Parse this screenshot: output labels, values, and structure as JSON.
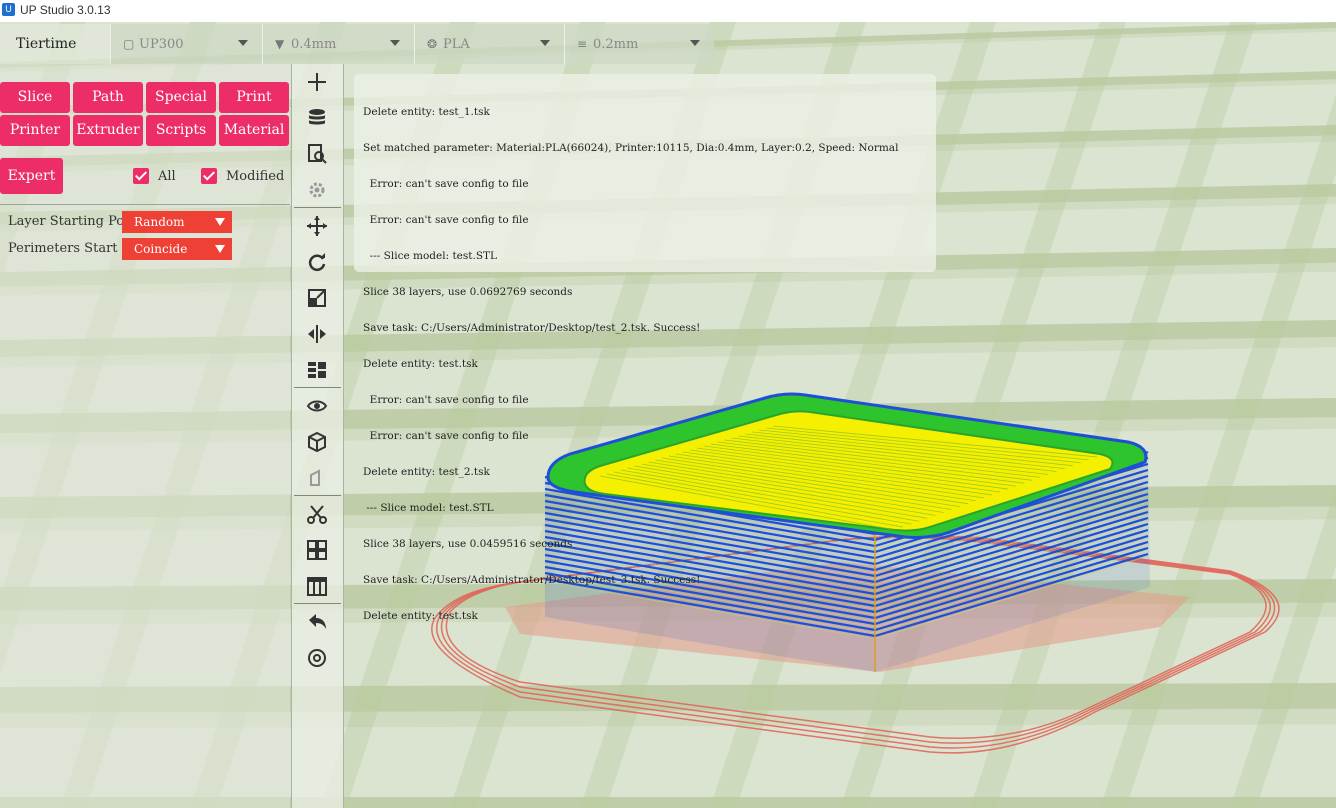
{
  "window": {
    "title": "UP Studio 3.0.13",
    "icon": "app-icon"
  },
  "topbar": {
    "brand": "Tiertime",
    "printer": {
      "icon": "square-icon",
      "value": "UP300"
    },
    "nozzle": {
      "icon": "triangle-down-icon",
      "value": "0.4mm"
    },
    "material": {
      "icon": "spool-icon",
      "value": "PLA"
    },
    "layer": {
      "icon": "lines-icon",
      "value": "0.2mm"
    }
  },
  "tabs": {
    "row1": [
      "Slice",
      "Path",
      "Special",
      "Print"
    ],
    "row2": [
      "Printer",
      "Extruder",
      "Scripts",
      "Material"
    ]
  },
  "options": {
    "expert": "Expert",
    "all": "All",
    "modified": "Modified"
  },
  "params": [
    {
      "label": "Layer Starting Point",
      "value": "Random"
    },
    {
      "label": "Perimeters Start",
      "value": "Coincide"
    }
  ],
  "tools": [
    "add-icon",
    "database-icon",
    "search-doc-icon",
    "gear-icon",
    "move-icon",
    "rotate-icon",
    "scale-icon",
    "mirror-icon",
    "layout-icon",
    "eye-icon",
    "cube-icon",
    "cut-icon",
    "grid-icon",
    "support-icon",
    "undo-icon",
    "at-icon"
  ],
  "log": [
    "Delete entity: test_1.tsk",
    "Set matched parameter: Material:PLA(66024), Printer:10115, Dia:0.4mm, Layer:0.2, Speed: Normal",
    "  Error: can't save config to file",
    "  Error: can't save config to file",
    "  --- Slice model: test.STL",
    "Slice 38 layers, use 0.0692769 seconds",
    "Save task: C:/Users/Administrator/Desktop/test_2.tsk. Success!",
    "Delete entity: test.tsk",
    "  Error: can't save config to file",
    "  Error: can't save config to file",
    "Delete entity: test_2.tsk",
    " --- Slice model: test.STL",
    "Slice 38 layers, use 0.0459516 seconds",
    "Save task: C:/Users/Administrator/Desktop/test_3.tsk. Success!",
    "Delete entity: test.tsk"
  ],
  "colors": {
    "accent": "#ec2d68",
    "select": "#ee4035",
    "perimeter": "#1f4fd6",
    "infill": "#f4f000",
    "inner": "#2ec42e",
    "raft": "#e0665a"
  }
}
